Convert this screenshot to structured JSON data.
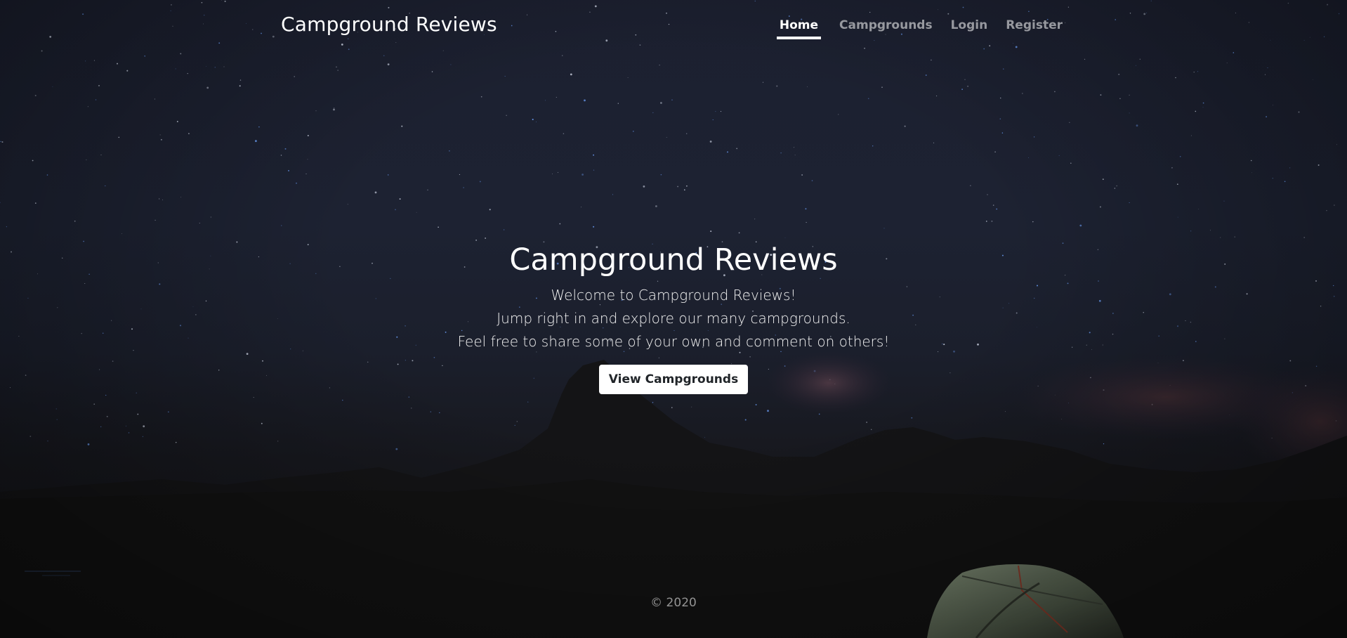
{
  "header": {
    "brand": "Campground Reviews",
    "nav": [
      {
        "label": "Home",
        "active": true
      },
      {
        "label": "Campgrounds",
        "active": false
      },
      {
        "label": "Login",
        "active": false
      },
      {
        "label": "Register",
        "active": false
      }
    ]
  },
  "hero": {
    "title": "Campground Reviews",
    "lines": [
      "Welcome to Campground Reviews!",
      "Jump right in and explore our many campgrounds.",
      "Feel free to share some of your own and comment on others!"
    ],
    "button_label": "View Campgrounds"
  },
  "footer": {
    "copyright": "© 2020"
  },
  "background": {
    "image": "starry-night-mountains-tent",
    "sky_color": "#1d2232",
    "ground_color": "#121212"
  }
}
